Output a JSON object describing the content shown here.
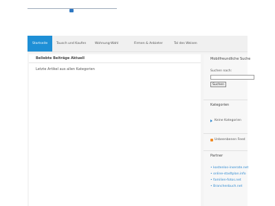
{
  "nav": {
    "items": [
      "Startseite",
      "Tausch und Kaufen",
      "Wohnung-Wahl",
      "Firmen & Anbieter",
      "Tal des Weisen"
    ]
  },
  "main": {
    "heading": "Beliebte Beiträge Aktuell",
    "text": "Letzte Artikel aus allen Kategorien"
  },
  "sidebar": {
    "search_title": "Mobilfreundliche Suche",
    "search_label": "Suchen nach:",
    "search_button": "Suchen",
    "categories_title": "Kategorien",
    "categories_item": "Keine Kategorien",
    "feed_label": "Unbeenbenen Feed",
    "partner_title": "Partner",
    "partners": [
      "• kostenlos-inserate.net",
      "• online-stadtplan.info",
      "• familien-fotos.net",
      "• Branchenbuch.net"
    ]
  },
  "colors": {
    "accent": "#1e8fd6"
  }
}
